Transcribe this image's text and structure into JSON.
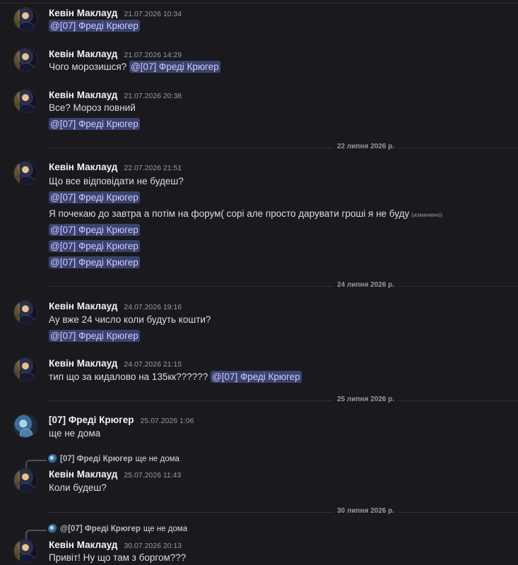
{
  "messages": [
    {
      "author": "Кевін Маклауд",
      "time": "21.07.2026 10:34",
      "line1": "@[07] Фреді Крюгер"
    },
    {
      "author": "Кевін Маклауд",
      "time": "21.07.2026 14:29",
      "text": "Чого морозишся?",
      "mention": "@[07] Фреді Крюгер"
    },
    {
      "author": "Кевін Маклауд",
      "time": "21.07.2026 20:38",
      "line1": "Все? Мороз повний",
      "line2": "@[07] Фреді Крюгер"
    },
    {
      "author": "Кевін Маклауд",
      "time": "22.07.2026 21:51",
      "line1": "Що все відповідати не будеш?",
      "line2": "@[07] Фреді Крюгер",
      "line3": "Я почекаю до завтра а потім на форум( сорі але просто дарувати гроші я не буду",
      "edited": "(изменено)",
      "line4": "@[07] Фреді Крюгер",
      "line5": "@[07] Фреді Крюгер",
      "line6": "@[07] Фреді Крюгер"
    },
    {
      "author": "Кевін Маклауд",
      "time": "24.07.2026 19:16",
      "line1": "Ау вже 24 число коли будуть кошти?",
      "line2": "@[07] Фреді Крюгер"
    },
    {
      "author": "Кевін Маклауд",
      "time": "24.07.2026 21:15",
      "text": "тип що за кидалово на 135кк??????",
      "mention": "@[07] Фреді Крюгер"
    },
    {
      "author": "[07] Фреді Крюгер",
      "time": "25.07.2026 1:06",
      "line1": "ще не дома"
    },
    {
      "author": "Кевін Маклауд",
      "time": "25.07.2026 11:43",
      "line1": "Коли будеш?",
      "reply_name": "[07] Фреді Крюгер",
      "reply_text": "ще не дома"
    },
    {
      "author": "Кевін Маклауд",
      "time": "30.07.2026 20:13",
      "line1": "Привіт! Ну що там з боргом???",
      "reply_name": "@[07] Фреді Крюгер",
      "reply_text": "ще не дома"
    }
  ],
  "dividers": [
    "22 липня 2026 р.",
    "24 липня 2026 р.",
    "25 липня 2026 р.",
    "30 липня 2026 р."
  ],
  "colors": {
    "background": "#1a1a1e",
    "mention_bg": "#3c4270",
    "mention_text": "#c9cdfb"
  }
}
